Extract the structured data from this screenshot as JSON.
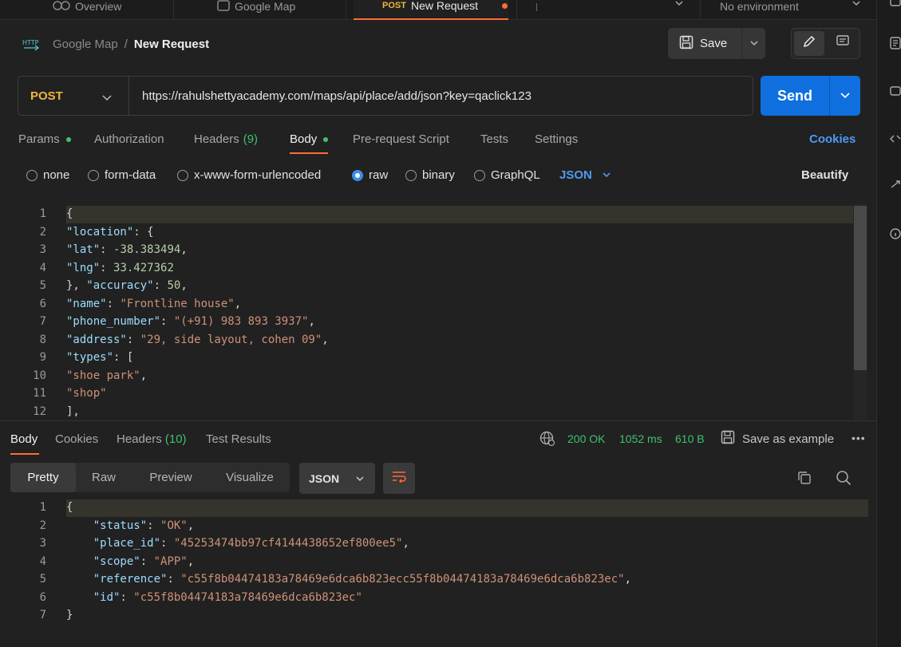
{
  "top_tabs": {
    "overview": "Overview",
    "google_map": "Google Map",
    "active_method": "POST",
    "active_title": "New Request",
    "environment": "No environment"
  },
  "header": {
    "collection": "Google Map",
    "separator": "/",
    "request_name": "New Request",
    "save_label": "Save"
  },
  "request": {
    "method": "POST",
    "url": "https://rahulshettyacademy.com/maps/api/place/add/json?key=qaclick123",
    "send_label": "Send"
  },
  "request_tabs": {
    "params": "Params",
    "authorization": "Authorization",
    "headers": "Headers",
    "headers_count": "(9)",
    "body": "Body",
    "pre_request": "Pre-request Script",
    "tests": "Tests",
    "settings": "Settings",
    "cookies": "Cookies"
  },
  "body_types": {
    "none": "none",
    "form_data": "form-data",
    "urlencoded": "x-www-form-urlencoded",
    "raw": "raw",
    "binary": "binary",
    "graphql": "GraphQL",
    "format": "JSON",
    "beautify": "Beautify",
    "selected": "raw"
  },
  "request_body_lines": [
    [
      [
        "p",
        "{"
      ]
    ],
    [
      [
        "k",
        "\"location\""
      ],
      [
        "p",
        ": {"
      ]
    ],
    [
      [
        "k",
        "\"lat\""
      ],
      [
        "p",
        ": "
      ],
      [
        "n",
        "-38.383494"
      ],
      [
        "p",
        ","
      ]
    ],
    [
      [
        "k",
        "\"lng\""
      ],
      [
        "p",
        ": "
      ],
      [
        "n",
        "33.427362"
      ]
    ],
    [
      [
        "p",
        "}, "
      ],
      [
        "k",
        "\"accuracy\""
      ],
      [
        "p",
        ": "
      ],
      [
        "n",
        "50"
      ],
      [
        "p",
        ","
      ]
    ],
    [
      [
        "k",
        "\"name\""
      ],
      [
        "p",
        ": "
      ],
      [
        "s",
        "\"Frontline house\""
      ],
      [
        "p",
        ","
      ]
    ],
    [
      [
        "k",
        "\"phone_number\""
      ],
      [
        "p",
        ": "
      ],
      [
        "s",
        "\"(+91) 983 893 3937\""
      ],
      [
        "p",
        ","
      ]
    ],
    [
      [
        "k",
        "\"address\""
      ],
      [
        "p",
        ": "
      ],
      [
        "s",
        "\"29, side layout, cohen 09\""
      ],
      [
        "p",
        ","
      ]
    ],
    [
      [
        "k",
        "\"types\""
      ],
      [
        "p",
        ": ["
      ]
    ],
    [
      [
        "s",
        "\"shoe park\""
      ],
      [
        "p",
        ","
      ]
    ],
    [
      [
        "s",
        "\"shop\""
      ]
    ],
    [
      [
        "p",
        "],"
      ]
    ]
  ],
  "response_tabs": {
    "body": "Body",
    "cookies": "Cookies",
    "headers": "Headers",
    "headers_count": "(10)",
    "test_results": "Test Results"
  },
  "response_status": {
    "code": "200 OK",
    "time": "1052 ms",
    "size": "610 B",
    "save_example": "Save as example"
  },
  "view_modes": {
    "pretty": "Pretty",
    "raw": "Raw",
    "preview": "Preview",
    "visualize": "Visualize",
    "format": "JSON"
  },
  "response_body_lines": [
    [
      [
        "p",
        "{"
      ]
    ],
    [
      [
        "p",
        "    "
      ],
      [
        "k",
        "\"status\""
      ],
      [
        "p",
        ": "
      ],
      [
        "s",
        "\"OK\""
      ],
      [
        "p",
        ","
      ]
    ],
    [
      [
        "p",
        "    "
      ],
      [
        "k",
        "\"place_id\""
      ],
      [
        "p",
        ": "
      ],
      [
        "s",
        "\"45253474bb97cf4144438652ef800ee5\""
      ],
      [
        "p",
        ","
      ]
    ],
    [
      [
        "p",
        "    "
      ],
      [
        "k",
        "\"scope\""
      ],
      [
        "p",
        ": "
      ],
      [
        "s",
        "\"APP\""
      ],
      [
        "p",
        ","
      ]
    ],
    [
      [
        "p",
        "    "
      ],
      [
        "k",
        "\"reference\""
      ],
      [
        "p",
        ": "
      ],
      [
        "s",
        "\"c55f8b04474183a78469e6dca6b823ecc55f8b04474183a78469e6dca6b823ec\""
      ],
      [
        "p",
        ","
      ]
    ],
    [
      [
        "p",
        "    "
      ],
      [
        "k",
        "\"id\""
      ],
      [
        "p",
        ": "
      ],
      [
        "s",
        "\"c55f8b04474183a78469e6dca6b823ec\""
      ]
    ],
    [
      [
        "p",
        "}"
      ]
    ]
  ],
  "colors": {
    "accent": "#ff6c37",
    "send": "#0f6fde",
    "success": "#3ec26e",
    "method_post": "#f0b43c"
  }
}
